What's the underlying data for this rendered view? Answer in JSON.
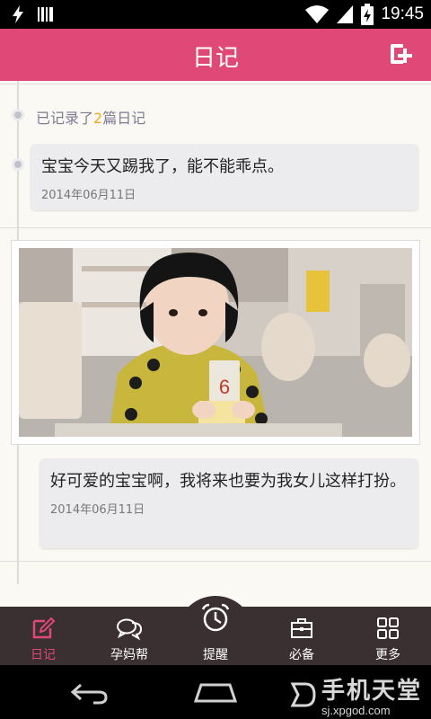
{
  "status_bar": {
    "time": "19:45"
  },
  "header": {
    "title": "日记"
  },
  "diary": {
    "count_prefix": "已记录了",
    "count_value": "2",
    "count_suffix": "篇日记",
    "entries": [
      {
        "text": "宝宝今天又踢我了，能不能乖点。",
        "date": "2014年06月11日"
      },
      {
        "text": "好可爱的宝宝啊，我将来也要为我女儿这样打扮。",
        "date": "2014年06月11日"
      }
    ]
  },
  "photo": {
    "card_number": "6"
  },
  "bottom_nav": [
    {
      "label": "日记",
      "icon": "pencil-icon",
      "active": true
    },
    {
      "label": "孕妈帮",
      "icon": "chat-bubbles-icon"
    },
    {
      "label": "提醒",
      "icon": "alarm-clock-icon"
    },
    {
      "label": "必备",
      "icon": "briefcase-icon"
    },
    {
      "label": "更多",
      "icon": "grid-icon"
    }
  ],
  "watermark": {
    "title": "手机天堂",
    "url": "sj.xpgod.com"
  },
  "colors": {
    "accent": "#e04878",
    "nav_bg": "#3a2f31",
    "count_highlight": "#f5a623"
  }
}
